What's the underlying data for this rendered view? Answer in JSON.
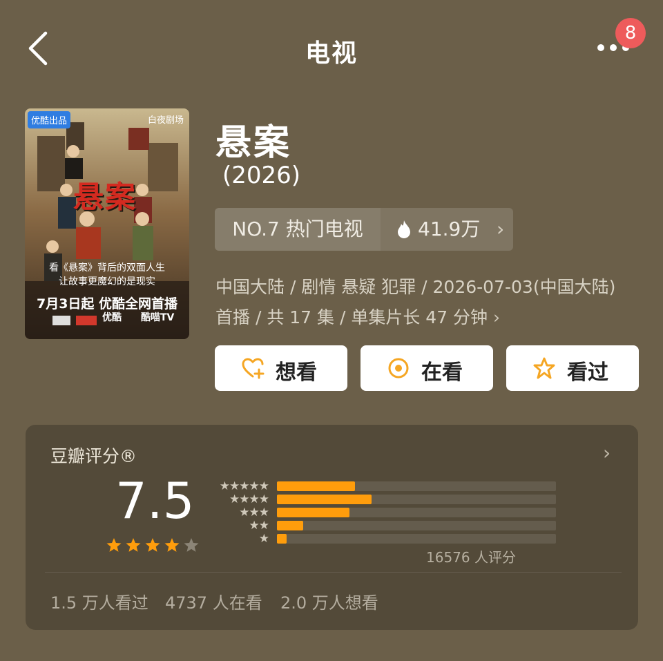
{
  "header": {
    "title": "电视",
    "notification_count": "8",
    "back_icon": "chevron-left-icon",
    "more_icon": "more-dots-icon"
  },
  "poster": {
    "tag": "优酷出品",
    "studio": "白夜剧场",
    "title": "悬案",
    "tagline1": "看《悬案》背后的双面人生",
    "tagline2": "让故事更魔幻的是现实",
    "premiere": "7月3日起 优酷全网首播",
    "platform1": "优酷",
    "platform2": "酷喵TV"
  },
  "show": {
    "title": "悬案",
    "year": "(2026)",
    "rank": "NO.7 热门电视",
    "heat": "41.9万",
    "meta_line1": "中国大陆 / 剧情 悬疑 犯罪 / 2026-07-03(中国大陆)",
    "meta_line2": "首播 / 共 17 集 / 单集片长 47 分钟"
  },
  "actions": [
    {
      "label": "想看",
      "icon": "heart-plus-icon",
      "color": "#f5a623"
    },
    {
      "label": "在看",
      "icon": "watching-target-icon",
      "color": "#f5a623"
    },
    {
      "label": "看过",
      "icon": "star-outline-icon",
      "color": "#f5a623"
    }
  ],
  "rating": {
    "heading": "豆瓣评分®",
    "score": "7.5",
    "stars": 4,
    "distribution": [
      {
        "stars": "★★★★★",
        "percent": 28
      },
      {
        "stars": "★★★★",
        "percent": 34
      },
      {
        "stars": "★★★",
        "percent": 26
      },
      {
        "stars": "★★",
        "percent": 9.5
      },
      {
        "stars": "★",
        "percent": 3.5
      }
    ],
    "count": "16576 人评分",
    "watched": "1.5 万人看过",
    "watching": "4737 人在看",
    "want": "2.0 万人想看"
  },
  "colors": {
    "background": "#6b5f49",
    "accent": "#ff9d0c",
    "badge": "#ee5b5b"
  }
}
